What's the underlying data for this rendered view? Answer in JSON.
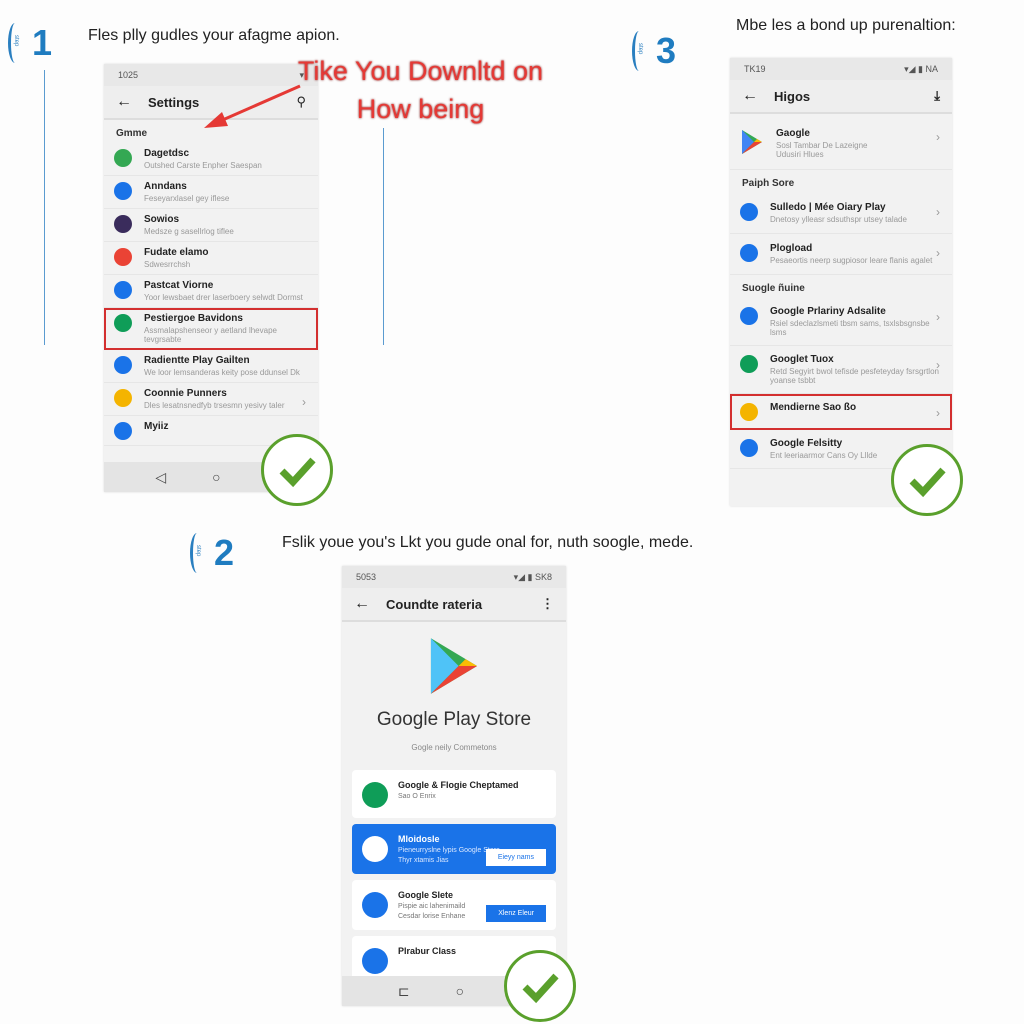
{
  "steps": [
    {
      "number": "1",
      "badge": "step",
      "caption": "Fles plly gudles your afagme apion."
    },
    {
      "number": "2",
      "badge": "step",
      "caption": "Fslik youe you's Lkt you gude onal for, nuth soogle, mede."
    },
    {
      "number": "3",
      "badge": "step",
      "caption": "Mbe les a bond up purenaltion:"
    }
  ],
  "annotation": {
    "line1": "Tike You Downltd on",
    "line2": "How being",
    "color": "#e53935"
  },
  "phone1": {
    "time": "1025",
    "status_right": "▾",
    "title": "Settings",
    "section": "Gmme",
    "items": [
      {
        "title": "Dagetdsc",
        "sub": "Outshed Carste Enpher Saespan",
        "icon": "play-store-icon",
        "color": "#34a853"
      },
      {
        "title": "Anndans",
        "sub": "Feseyarxlasel gey iflese",
        "icon": "square-app-icon",
        "color": "#1a73e8"
      },
      {
        "title": "Sowios",
        "sub": "Medsze g sasellrlog tiflee",
        "icon": "galaxy-app-icon",
        "color": "#3a2c5c"
      },
      {
        "title": "Fudate elamo",
        "sub": "Sdwesrrchsh",
        "icon": "chrome-icon",
        "color": "#ea4335"
      },
      {
        "title": "Pastcat Viorne",
        "sub": "Yoor lewsbaet drer laserboery selwdt Dormst",
        "icon": "ring-icon",
        "color": "#1a73e8"
      },
      {
        "title": "Pestiergoe Bavidons",
        "sub": "Assmalapshenseor y aetland lhevape tevgrsabte",
        "icon": "play-outline-icon",
        "color": "#0f9d58",
        "highlight": true
      },
      {
        "title": "Radientte Play Gailten",
        "sub": "We loor lemsanderas keity pose ddunsel Dk",
        "icon": "accessibility-icon",
        "color": "#1a73e8"
      },
      {
        "title": "Coonnie Punners",
        "sub": "Dles lesatnsnedfyb trsesmn yesivy taler",
        "icon": "bolt-icon",
        "color": "#f4b400",
        "chevron": true
      },
      {
        "title": "Myiiz",
        "sub": "",
        "icon": "person-app-icon",
        "color": "#1a73e8"
      }
    ]
  },
  "phone3": {
    "time": "TK19",
    "status_right": "▾◢ ▮ NA",
    "title": "Higos",
    "top_item": {
      "title": "Gaogle",
      "sub": "Sosl Tambar De Lazeigne Udusiri Hlues",
      "icon": "play-store-icon"
    },
    "section1": "Paiph Sore",
    "items1": [
      {
        "title": "Sulledo | Mée Oiary Play",
        "sub": "Dnetosy ylleasr sdsuthspr utsey talade",
        "icon": "person-icon",
        "color": "#1a73e8"
      },
      {
        "title": "Plogload",
        "sub": "Pesaeortis neerp sugpiosor leare flanis agalet",
        "icon": "download-icon",
        "color": "#1a73e8"
      }
    ],
    "section2": "Suogle ñuine",
    "items2": [
      {
        "title": "Google Prlariny Adsalite",
        "sub": "Rsiel sdeclazlsmeti tbsm sams, tsxlsbsgnsbe lsms",
        "icon": "camera-icon",
        "color": "#1a73e8"
      },
      {
        "title": "Googlet Tuox",
        "sub": "Retd Segyirt bwol tefisde pesfeteyday fsrsgrtlon yoanse tsbbt",
        "icon": "play-outline-icon",
        "color": "#0f9d58"
      },
      {
        "title": "Mendierne Sao ßo",
        "sub": "",
        "icon": "photos-icon",
        "color": "#f4b400",
        "highlight": true
      },
      {
        "title": "Google Felsitty",
        "sub": "Ent leeriaarmor Cans Oy Lllde",
        "icon": "phone-icon",
        "color": "#1a73e8"
      }
    ]
  },
  "phone2": {
    "time": "5053",
    "status_right": "▾◢ ▮ SK8",
    "title": "Coundte rateria",
    "app_name": "Google Play Store",
    "app_sub": "Gogle neily Commetons",
    "cards": [
      {
        "title": "Google & Flogie Cheptamed",
        "sub": "Sao O Enrix",
        "icon": "stamp-icon",
        "color": "#0f9d58"
      },
      {
        "title": "Mloidosle",
        "sub": "Pieneurryslne lypis Google Store",
        "sub2": "Thyr xtamis Jias",
        "button": "Eieyy nams",
        "icon": "calendar-icon",
        "blue": true
      },
      {
        "title": "Google Slete",
        "sub": "Pispie aic lahenimaild",
        "sub2": "Cesdar lorise Enhane",
        "button": "Xlenz Eleur",
        "icon": "list-icon",
        "color": "#1a73e8"
      },
      {
        "title": "Plrabur Class",
        "sub": "",
        "icon": "circle-icon",
        "color": "#1a73e8"
      }
    ]
  },
  "colors": {
    "accent": "#1f7cc0",
    "highlight": "#d32f2f",
    "check": "#5aa02c"
  }
}
